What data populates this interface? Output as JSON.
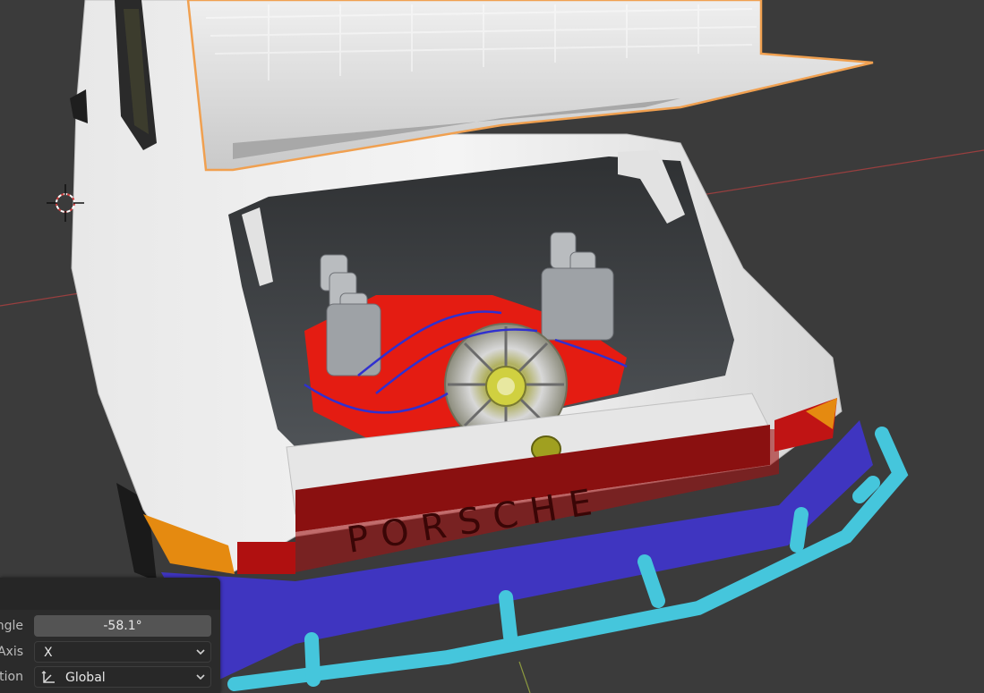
{
  "viewport": {
    "object": "Porsche 911 rear with open engine lid",
    "badge_text": "PORSCHE",
    "colors": {
      "background": "#3b3b3b",
      "car_body": "#dcdcdc",
      "engine_red": "#e41c12",
      "bumper_blue": "#3f35c0",
      "guard_cyan": "#45c6dc",
      "selection_outline": "#f0a050",
      "x_axis": "#b04040",
      "y_axis": "#a0b040"
    }
  },
  "operator_panel": {
    "angle": {
      "label": "ngle",
      "value": "-58.1°"
    },
    "axis": {
      "label": "Axis",
      "value": "X",
      "icon": "chevron-down-icon"
    },
    "orientation": {
      "label": "tion",
      "value": "Global",
      "icon": "orientation-axes-icon"
    }
  }
}
